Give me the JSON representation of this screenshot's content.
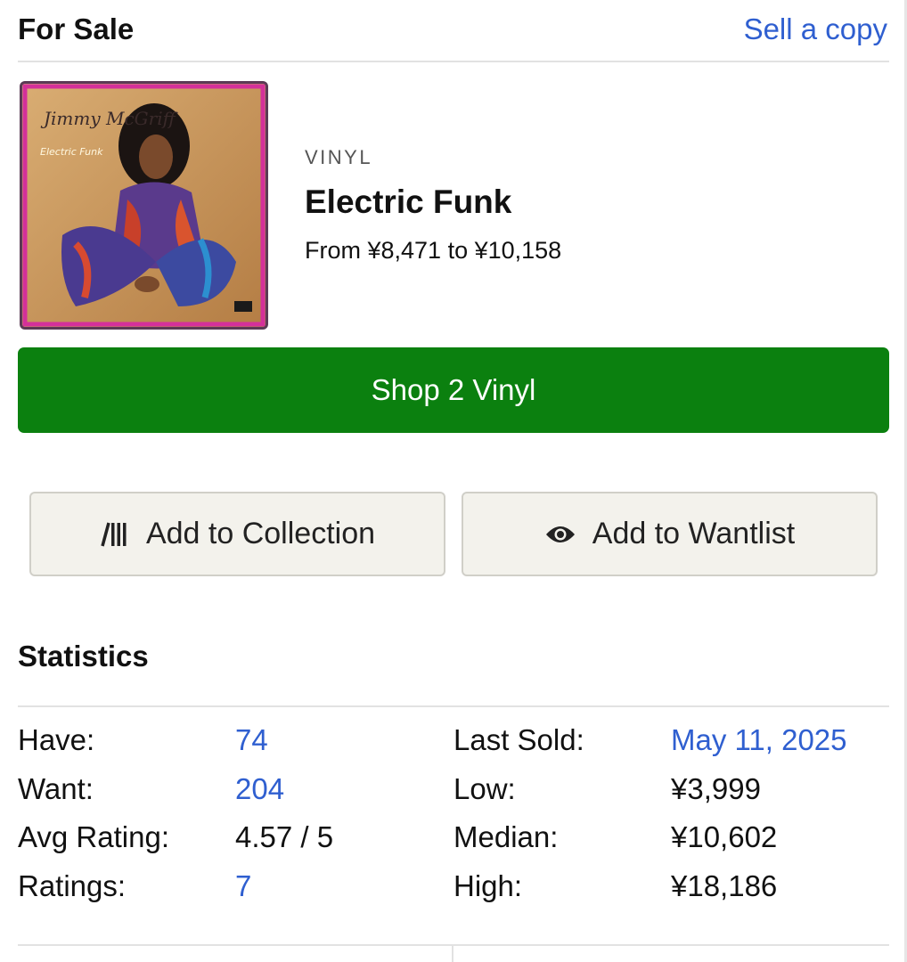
{
  "header": {
    "title": "For Sale",
    "sell_link": "Sell a copy"
  },
  "release": {
    "cover": {
      "artist_text": "Jimmy McGriff",
      "album_text": "Electric Funk"
    },
    "format": "VINYL",
    "title": "Electric Funk",
    "price_range": "From ¥8,471 to ¥10,158"
  },
  "shop_button": {
    "label": "Shop 2 Vinyl",
    "color": "#0b800f"
  },
  "actions": {
    "collection": {
      "label": "Add to Collection",
      "icon": "collection-icon"
    },
    "wantlist": {
      "label": "Add to Wantlist",
      "icon": "eye-icon"
    }
  },
  "statistics": {
    "title": "Statistics",
    "left": [
      {
        "label": "Have:",
        "value": "74"
      },
      {
        "label": "Want:",
        "value": "204"
      },
      {
        "label": "Avg Rating:",
        "value": "4.57 / 5"
      },
      {
        "label": "Ratings:",
        "value": "7"
      }
    ],
    "right": [
      {
        "label": "Last Sold:",
        "value": "May 11, 2025"
      },
      {
        "label": "Low:",
        "value": "¥3,999"
      },
      {
        "label": "Median:",
        "value": "¥10,602"
      },
      {
        "label": "High:",
        "value": "¥18,186"
      }
    ]
  },
  "colors": {
    "link": "#2f5fd0",
    "shop_green": "#0b800f",
    "button_bg": "#f3f2ec"
  }
}
